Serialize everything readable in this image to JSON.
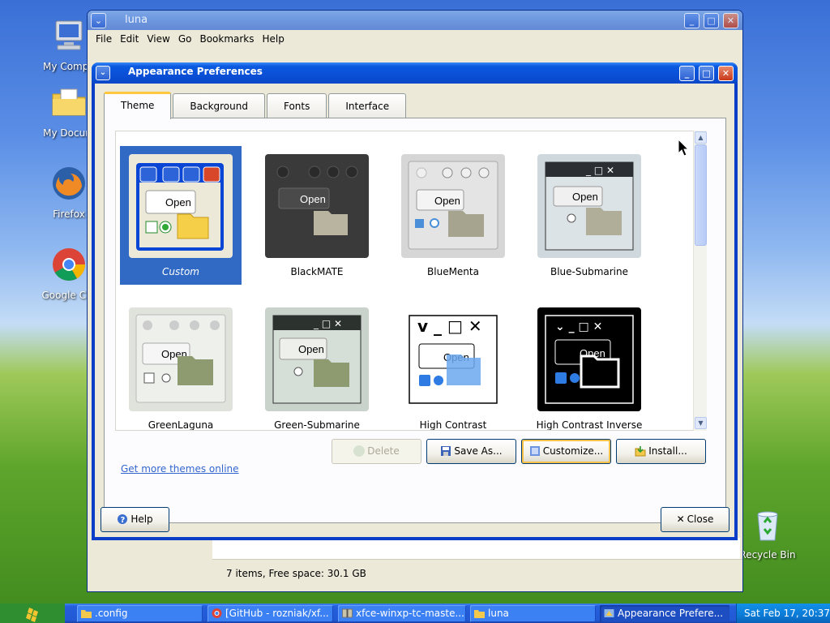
{
  "desktop": {
    "icons": [
      {
        "label": "My Compu"
      },
      {
        "label": "My Docum"
      },
      {
        "label": "Firefox"
      },
      {
        "label": "Google Chr"
      },
      {
        "label": "Recycle Bin"
      }
    ]
  },
  "file_manager": {
    "title": "luna",
    "menu": [
      "File",
      "Edit",
      "View",
      "Go",
      "Bookmarks",
      "Help"
    ],
    "status": "7 items, Free space: 30.1 GB"
  },
  "dialog": {
    "title": "Appearance Preferences",
    "tabs": [
      "Theme",
      "Background",
      "Fonts",
      "Interface"
    ],
    "active_tab": "Theme",
    "themes": [
      {
        "name": "Custom",
        "selected": true
      },
      {
        "name": "BlackMATE"
      },
      {
        "name": "BlueMenta"
      },
      {
        "name": "Blue-Submarine"
      },
      {
        "name": "GreenLaguna"
      },
      {
        "name": "Green-Submarine"
      },
      {
        "name": "High Contrast"
      },
      {
        "name": "High Contrast Inverse"
      }
    ],
    "thumb_text": "Open",
    "buttons": {
      "delete": "Delete",
      "save_as": "Save As...",
      "customize": "Customize...",
      "install": "Install..."
    },
    "link": "Get more themes online",
    "help": "Help",
    "close": "Close"
  },
  "taskbar": {
    "items": [
      {
        "label": ".config"
      },
      {
        "label": "[GitHub - rozniak/xf..."
      },
      {
        "label": "xfce-winxp-tc-maste..."
      },
      {
        "label": "luna"
      },
      {
        "label": "Appearance Prefere...",
        "active": true
      }
    ],
    "clock": "Sat Feb 17, 20:37"
  },
  "colors": {
    "selection": "#316ac5",
    "title_bar": "#0a4fd6",
    "dialog_bg": "#ece9d8",
    "link": "#3366cc"
  }
}
